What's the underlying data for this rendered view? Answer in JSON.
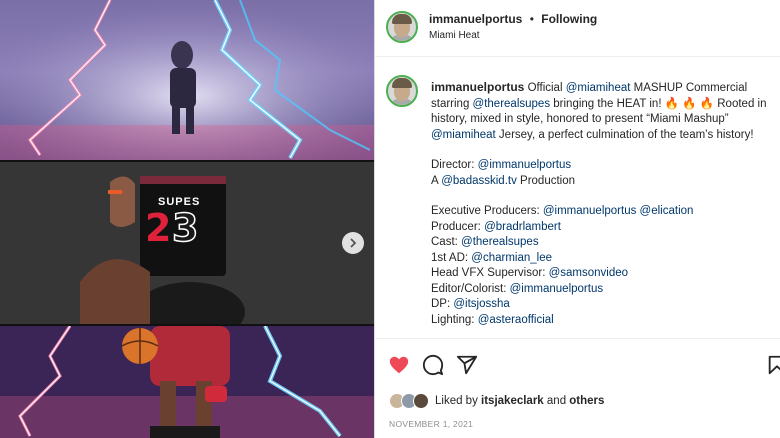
{
  "post": {
    "header": {
      "username": "immanuelportus",
      "separator": "•",
      "follow_status": "Following",
      "location": "Miami Heat"
    },
    "caption": {
      "username": "immanuelportus",
      "line1_a": "Official ",
      "line1_mention": "@miamiheat",
      "line1_b": " MASHUP Commercial",
      "line2_a": "starring ",
      "line2_mention": "@therealsupes",
      "line2_b": " bringing the HEAT in! 🔥 🔥 🔥 Rooted in history, mixed in style, honored to present “Miami Mashup” ",
      "line2_mention2": "@miamiheat",
      "line2_c": " Jersey, a perfect culmination of the team’s history!",
      "credits_block1": [
        {
          "label": "Director: ",
          "mention": "@immanuelportus",
          "suffix": ""
        },
        {
          "label": "A ",
          "mention": "@badasskid.tv",
          "suffix": " Production"
        }
      ],
      "credits_block2": [
        {
          "label": "Executive Producers: ",
          "mention": "@immanuelportus",
          "mention2": " @elication"
        },
        {
          "label": "Producer: ",
          "mention": "@bradrlambert",
          "mention2": ""
        },
        {
          "label": "Cast: ",
          "mention": "@therealsupes",
          "mention2": ""
        },
        {
          "label": "1st AD: ",
          "mention": "@charmian_lee",
          "mention2": ""
        },
        {
          "label": "Head VFX Supervisor: ",
          "mention": "@samsonvideo",
          "mention2": ""
        },
        {
          "label": "Editor/Colorist: ",
          "mention": "@immanuelportus",
          "mention2": ""
        },
        {
          "label": "DP: ",
          "mention": "@itsjossha",
          "mention2": ""
        },
        {
          "label": "Lighting: ",
          "mention": "@asteraofficial",
          "mention2": ""
        }
      ]
    },
    "media": {
      "jersey_name": "SUPES",
      "jersey_number_left": "2",
      "jersey_number_right": "3"
    },
    "likes": {
      "prefix": "Liked by ",
      "user": "itsjakeclark",
      "middle": " and ",
      "others": "others"
    },
    "date": "NOVEMBER 1, 2021",
    "colors": {
      "like_red": "#ed4956",
      "link_blue": "#00376b",
      "avatar_ring": "#4caf50"
    },
    "icons": [
      "heart-icon",
      "comment-icon",
      "share-icon",
      "bookmark-icon",
      "chevron-right-icon"
    ]
  }
}
